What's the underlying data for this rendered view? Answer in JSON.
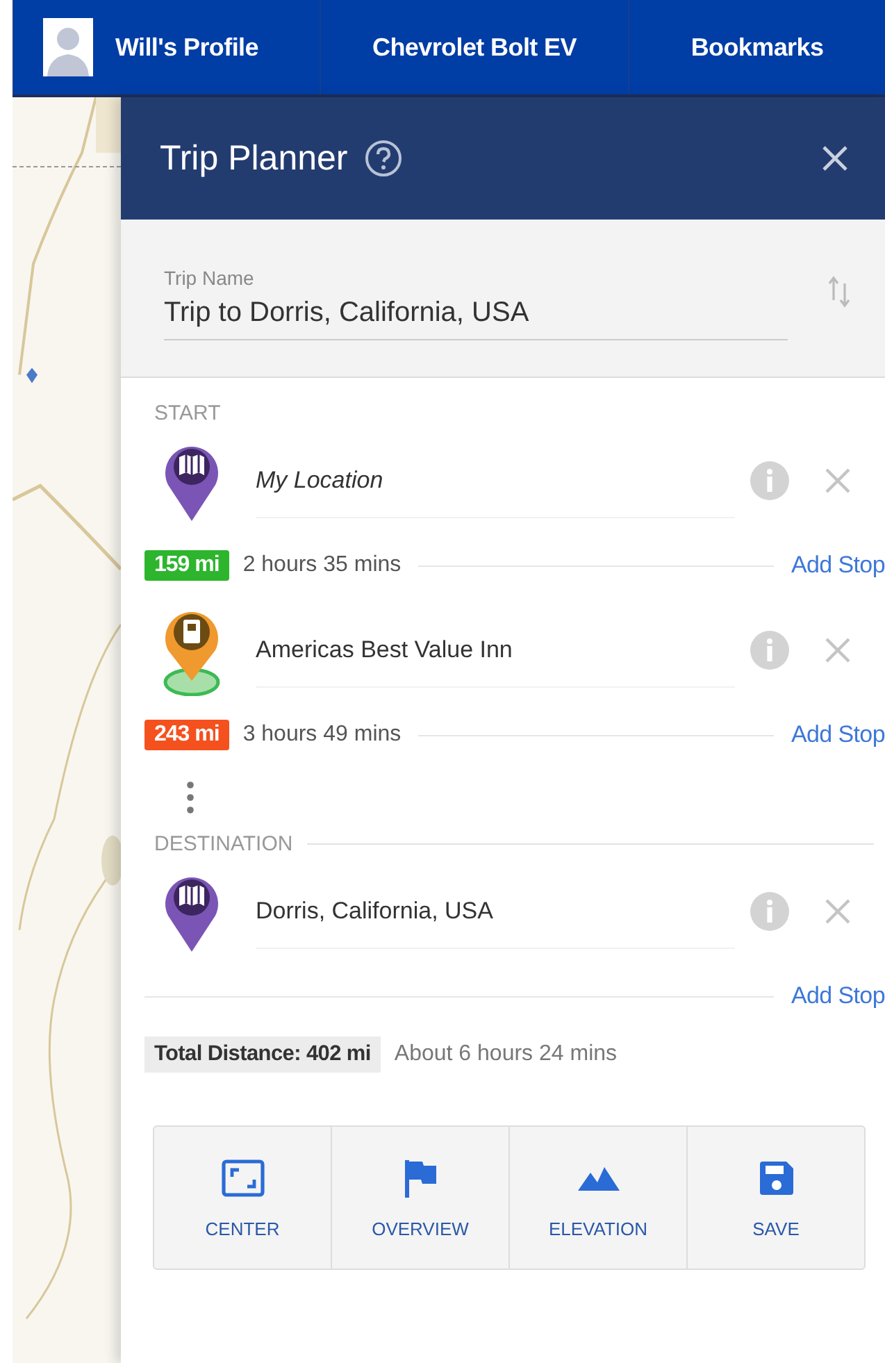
{
  "nav": {
    "profile": "Will's Profile",
    "items": [
      "Chevrolet Bolt EV",
      "Bookmarks"
    ]
  },
  "panel": {
    "title": "Trip Planner",
    "trip_name": {
      "label": "Trip Name",
      "value": "Trip to Dorris, California, USA"
    }
  },
  "route": [
    {
      "kind": "heading",
      "label": "START",
      "rule": false
    },
    {
      "kind": "stop",
      "pin": {
        "kind": "map"
      },
      "name": "My Location",
      "emphasized": true
    },
    {
      "kind": "leg",
      "distance": "159 mi",
      "color": "#2db52d",
      "duration": "2 hours 35 mins",
      "link": "Add Stop"
    },
    {
      "kind": "stop",
      "pin": {
        "kind": "lodging"
      },
      "name": "Americas Best Value Inn",
      "emphasized": false
    },
    {
      "kind": "leg",
      "distance": "243 mi",
      "color": "#f4511e",
      "duration": "3 hours 49 mins",
      "link": "Add Stop"
    },
    {
      "kind": "more"
    },
    {
      "kind": "heading",
      "label": "DESTINATION",
      "rule": true
    },
    {
      "kind": "stop",
      "pin": {
        "kind": "map"
      },
      "name": "Dorris, California, USA",
      "emphasized": false
    },
    {
      "kind": "add",
      "link": "Add Stop"
    }
  ],
  "total": {
    "distance": "Total Distance: 402 mi",
    "duration": "About 6 hours 24 mins"
  },
  "actions": [
    {
      "kind": "center",
      "label": "CENTER"
    },
    {
      "kind": "overview",
      "label": "OVERVIEW"
    },
    {
      "kind": "elevation",
      "label": "ELEVATION"
    },
    {
      "kind": "save",
      "label": "SAVE"
    }
  ]
}
